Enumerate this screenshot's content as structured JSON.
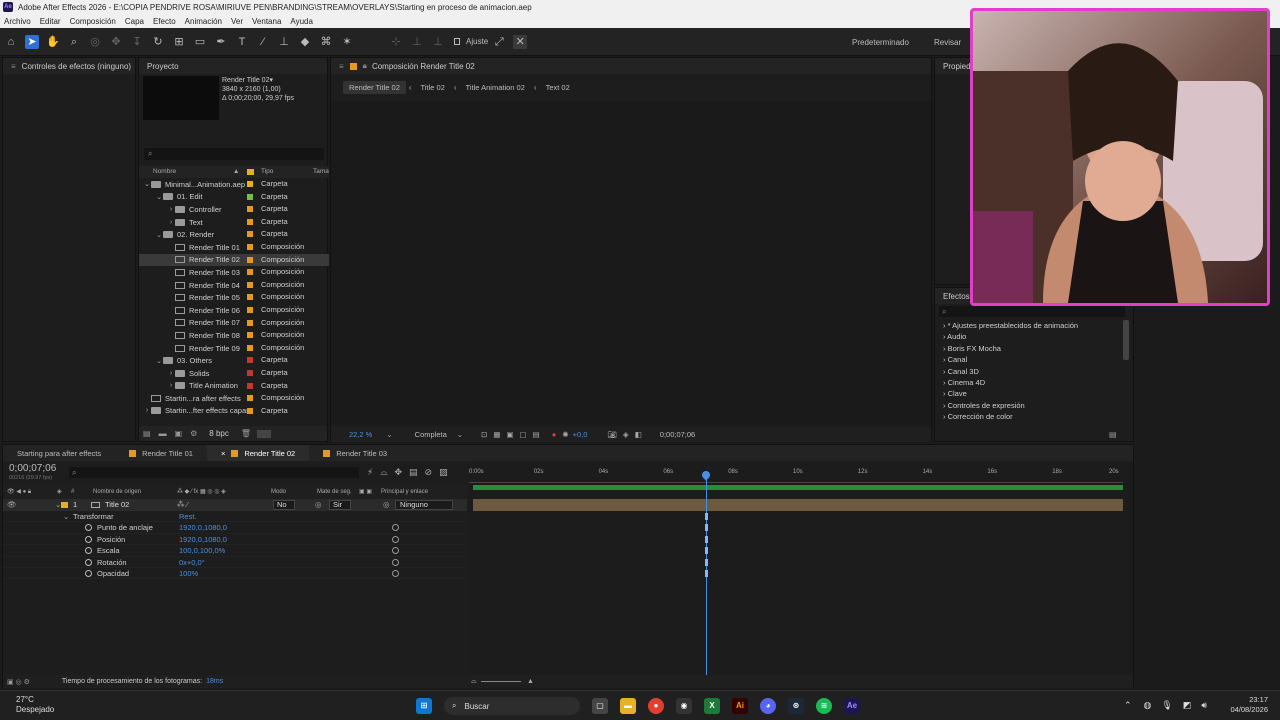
{
  "titlebar": {
    "app_icon": "Ae",
    "title": "Adobe After Effects 2026 - E:\\COPIA PENDRIVE ROSA\\MIRIUVE PEN\\BRANDING\\STREAM\\OVERLAYS\\Starting en proceso de animacion.aep"
  },
  "menu": [
    "Archivo",
    "Editar",
    "Composición",
    "Capa",
    "Efecto",
    "Animación",
    "Ver",
    "Ventana",
    "Ayuda"
  ],
  "toolbar": {
    "ajuste_label": "Ajuste",
    "workspace_default": "Predeterminado",
    "workspace_review": "Revisar"
  },
  "effects_controls": {
    "title": "Controles de efectos (ninguno)"
  },
  "project": {
    "title": "Proyecto",
    "selected_name": "Render Title 02▾",
    "selected_res": "3840 x 2160 (1,00)",
    "selected_dur": "Δ 0;00;20;00, 29,97 fps",
    "search_placeholder": "⌕",
    "col_name": "Nombre",
    "col_type": "Tipo",
    "col_size": "Tama",
    "bpc": "8 bpc",
    "items": [
      {
        "name": "Minimal...Animation.aep",
        "type": "Carpeta",
        "indent": 0,
        "kind": "folder",
        "open": true,
        "color": "#e5b21e"
      },
      {
        "name": "01. Edit",
        "type": "Carpeta",
        "indent": 1,
        "kind": "folder",
        "open": true,
        "color": "#6fbf4a"
      },
      {
        "name": "Controller",
        "type": "Carpeta",
        "indent": 2,
        "kind": "folder",
        "open": false,
        "color": "#e59a1e"
      },
      {
        "name": "Text",
        "type": "Carpeta",
        "indent": 2,
        "kind": "folder",
        "open": false,
        "color": "#e59a1e"
      },
      {
        "name": "02. Render",
        "type": "Carpeta",
        "indent": 1,
        "kind": "folder",
        "open": true,
        "color": "#e59a1e"
      },
      {
        "name": "Render Title 01",
        "type": "Composición",
        "indent": 2,
        "kind": "comp",
        "color": "#e59a1e"
      },
      {
        "name": "Render Title 02",
        "type": "Composición",
        "indent": 2,
        "kind": "comp",
        "color": "#e59a1e",
        "selected": true
      },
      {
        "name": "Render Title 03",
        "type": "Composición",
        "indent": 2,
        "kind": "comp",
        "color": "#e59a1e"
      },
      {
        "name": "Render Title 04",
        "type": "Composición",
        "indent": 2,
        "kind": "comp",
        "color": "#e59a1e"
      },
      {
        "name": "Render Title 05",
        "type": "Composición",
        "indent": 2,
        "kind": "comp",
        "color": "#e59a1e"
      },
      {
        "name": "Render Title 06",
        "type": "Composición",
        "indent": 2,
        "kind": "comp",
        "color": "#e59a1e"
      },
      {
        "name": "Render Title 07",
        "type": "Composición",
        "indent": 2,
        "kind": "comp",
        "color": "#e59a1e"
      },
      {
        "name": "Render Title 08",
        "type": "Composición",
        "indent": 2,
        "kind": "comp",
        "color": "#e59a1e"
      },
      {
        "name": "Render Title 09",
        "type": "Composición",
        "indent": 2,
        "kind": "comp",
        "color": "#e59a1e"
      },
      {
        "name": "03. Others",
        "type": "Carpeta",
        "indent": 1,
        "kind": "folder",
        "open": true,
        "color": "#c0392b"
      },
      {
        "name": "Solids",
        "type": "Carpeta",
        "indent": 2,
        "kind": "folder",
        "open": false,
        "color": "#c0392b"
      },
      {
        "name": "Title Animation",
        "type": "Carpeta",
        "indent": 2,
        "kind": "folder",
        "open": false,
        "color": "#c0392b"
      },
      {
        "name": "Startin...ra after effects",
        "type": "Composición",
        "indent": 0,
        "kind": "comp",
        "color": "#e59a1e"
      },
      {
        "name": "Startin...fter effects capas",
        "type": "Carpeta",
        "indent": 0,
        "kind": "folder",
        "open": false,
        "color": "#e59a1e"
      }
    ]
  },
  "composition": {
    "title": "Composición Render Title 02",
    "breadcrumbs": [
      "Render Title 02",
      "Title 02",
      "Title Animation 02",
      "Text 02"
    ],
    "zoom": "22,2 %",
    "quality": "Completa",
    "exposure": "+0,0",
    "timecode": "0;00;07;06"
  },
  "right_panel": {
    "title": "Propied",
    "effects_title": "Efectos y",
    "effects": [
      "* Ajustes preestablecidos de animación",
      "Audio",
      "Boris FX Mocha",
      "Canal",
      "Canal 3D",
      "Cinema 4D",
      "Clave",
      "Controles de expresión",
      "Corrección de color"
    ]
  },
  "timeline": {
    "tabs": [
      {
        "label": "Starting para after effects",
        "color": "",
        "active": false
      },
      {
        "label": "Render Title 01",
        "color": "#e59a1e",
        "active": false
      },
      {
        "label": "Render Title 02",
        "color": "#e59a1e",
        "active": true
      },
      {
        "label": "Render Title 03",
        "color": "#e59a1e",
        "active": false
      }
    ],
    "timecode": "0;00;07;06",
    "timecode_sub": "00216 (29.97 fps)",
    "col_layer_name": "Nombre de origen",
    "col_mode": "Modo",
    "col_matte": "Mate de seg.",
    "col_parent": "Principal y enlace",
    "ruler": [
      "0:00s",
      "02s",
      "04s",
      "06s",
      "08s",
      "10s",
      "12s",
      "14s",
      "16s",
      "18s",
      "20s"
    ],
    "playhead_seconds": 7.2,
    "duration_seconds": 20,
    "layer": {
      "number": "1",
      "name": "Title 02",
      "mode": "No",
      "matte": "Sir",
      "parent": "Ninguno"
    },
    "group": "Transformar",
    "reset": "Rest.",
    "props": [
      {
        "name": "Punto de anclaje",
        "value": "1920,0,1080,0"
      },
      {
        "name": "Posición",
        "value": "1920,0,1080,0"
      },
      {
        "name": "Escala",
        "value": "100,0,100,0%"
      },
      {
        "name": "Rotación",
        "value": "0x+0,0°"
      },
      {
        "name": "Opacidad",
        "value": "100%"
      }
    ],
    "status": "Tiempo de procesamiento de los fotogramas:",
    "status_value": "18ms"
  },
  "taskbar": {
    "weather_temp": "27°C",
    "weather_text": "Despejado",
    "search": "Buscar",
    "time": "23:17",
    "date": "04/08/2026"
  }
}
